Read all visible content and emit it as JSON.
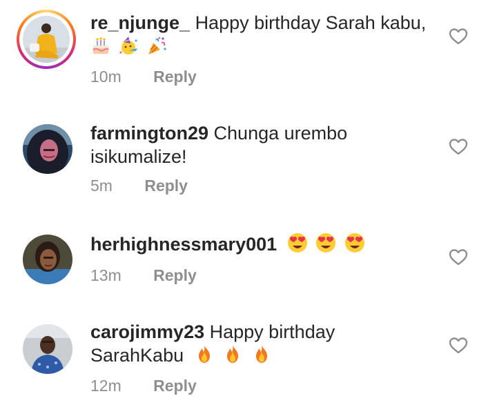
{
  "comments": [
    {
      "username": "re_njunge_",
      "text": "Happy birthday Sarah kabu,",
      "emojis": [
        "birthday-cake-emoji",
        "party-face-emoji",
        "party-popper-emoji"
      ],
      "time": "10m",
      "reply_label": "Reply",
      "has_story_ring": true
    },
    {
      "username": "farmington29",
      "text": "Chunga urembo isikumalize!",
      "emojis": [],
      "time": "5m",
      "reply_label": "Reply",
      "has_story_ring": false
    },
    {
      "username": "herhighnessmary001",
      "text": "",
      "emojis": [
        "heart-eyes-emoji",
        "heart-eyes-emoji",
        "heart-eyes-emoji"
      ],
      "time": "13m",
      "reply_label": "Reply",
      "has_story_ring": false
    },
    {
      "username": "carojimmy23",
      "text": "Happy birthday SarahKabu",
      "emojis": [
        "fire-emoji",
        "fire-emoji",
        "fire-emoji"
      ],
      "time": "12m",
      "reply_label": "Reply",
      "has_story_ring": false
    }
  ],
  "icons": {
    "like": "heart-outline-icon"
  },
  "colors": {
    "text": "#262626",
    "meta": "#8e8e8e",
    "like_stroke": "#8e8e8e"
  }
}
